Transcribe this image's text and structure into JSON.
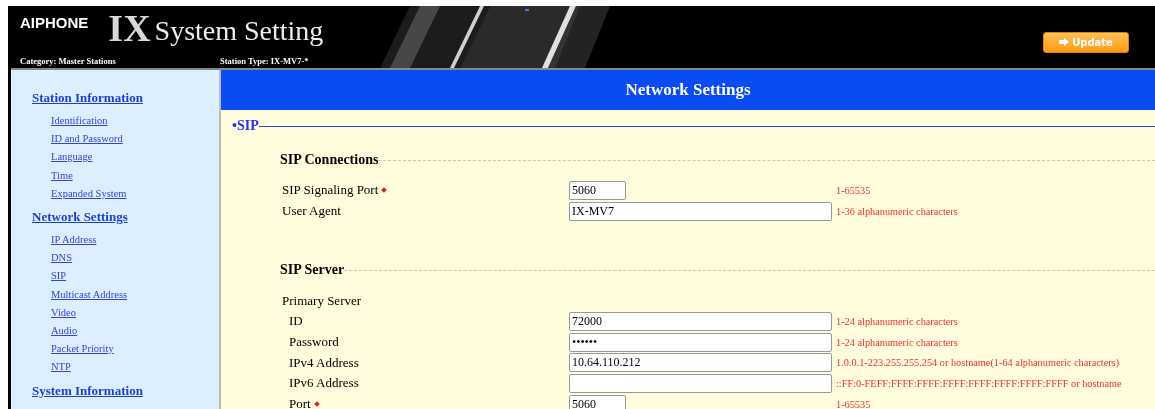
{
  "header": {
    "brand": "AIPHONE",
    "product_mark": "IX",
    "product": "System Setting",
    "category_label": "Category:",
    "category": "Master Stations",
    "station_type_label": "Station Type:",
    "station_type": "IX-MV7-*",
    "update_button": "Update"
  },
  "sidebar": {
    "sections": [
      {
        "title": "Station Information",
        "items": [
          "Identification",
          "ID and Password",
          "Language",
          "Time",
          "Expanded System"
        ]
      },
      {
        "title": "Network Settings",
        "items": [
          "IP Address",
          "DNS",
          "SIP",
          "Multicast Address",
          "Video",
          "Audio",
          "Packet Priority",
          "NTP"
        ]
      },
      {
        "title": "System Information"
      }
    ]
  },
  "page_title": "Network Settings",
  "section": {
    "bullet": "•",
    "title": "SIP"
  },
  "groups": [
    {
      "title": "SIP Connections",
      "rows": [
        {
          "kind": "short_field",
          "label": "SIP Signaling Port",
          "required": true,
          "value": "5060",
          "hint": "1-65535"
        },
        {
          "kind": "long_field",
          "label": "User Agent",
          "value": "IX-MV7",
          "hint": "1-36 alphanumeric characters"
        }
      ]
    },
    {
      "title": "SIP Server",
      "rows": [
        {
          "kind": "label",
          "label": "Primary Server",
          "children": [
            {
              "kind": "long_field",
              "label": "ID",
              "value": "72000",
              "hint": "1-24 alphanumeric characters"
            },
            {
              "kind": "long_field",
              "label": "Password",
              "value": "••••••",
              "hint": "1-24 alphanumeric characters"
            },
            {
              "kind": "long_field",
              "label": "IPv4 Address",
              "value": "10.64.110.212",
              "hint": "1.0.0.1-223.255.255.254 or hostname(1-64 alphanumeric characters)"
            },
            {
              "kind": "long_field",
              "label": "IPv6 Address",
              "hint": "::FF:0-FEFF:FFFF:FFFF:FFFF:FFFF:FFFF:FFFF:FFFF or hostname"
            },
            {
              "kind": "short_field",
              "label": "Port",
              "required": true,
              "value": "5060",
              "hint": "1-65535"
            }
          ]
        }
      ]
    }
  ]
}
